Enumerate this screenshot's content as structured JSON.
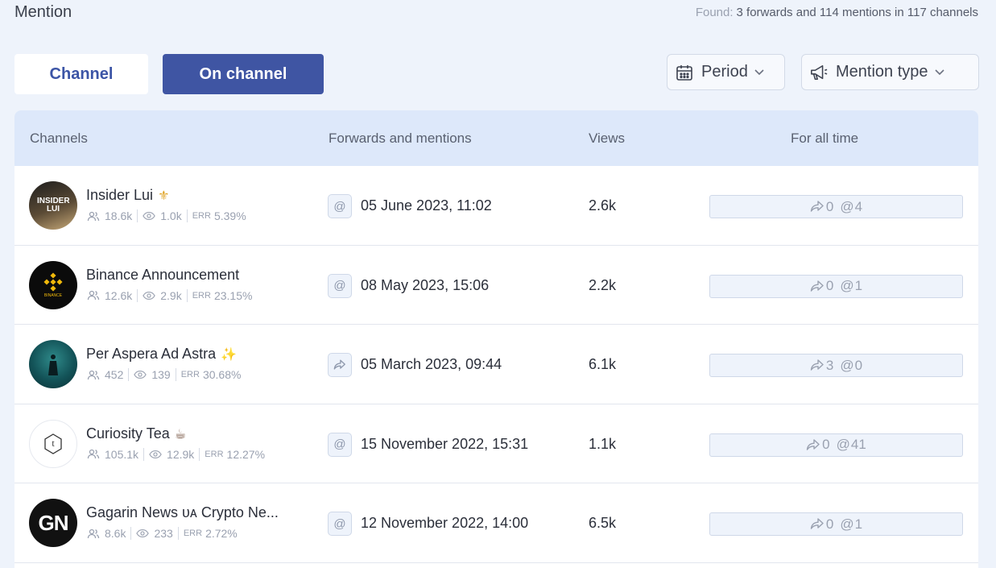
{
  "header": {
    "title": "Mention",
    "found_label": "Found:",
    "found_text": "3 forwards and 114 mentions in 117 channels"
  },
  "tabs": {
    "channel": "Channel",
    "on_channel": "On channel"
  },
  "filters": {
    "period": "Period",
    "mention_type": "Mention type"
  },
  "table": {
    "columns": {
      "channels": "Channels",
      "forwards": "Forwards and mentions",
      "views": "Views",
      "all_time": "For all time"
    },
    "rows": [
      {
        "name": "Insider Lui",
        "emoji": "⚜",
        "subscribers": "18.6k",
        "reach": "1.0k",
        "err_label": "ERR",
        "err": "5.39%",
        "type_icon": "at-icon",
        "date": "05 June 2023, 11:02",
        "views": "2.6k",
        "forwards": "0",
        "mentions": "4"
      },
      {
        "name": "Binance Announcement",
        "emoji": "",
        "subscribers": "12.6k",
        "reach": "2.9k",
        "err_label": "ERR",
        "err": "23.15%",
        "type_icon": "at-icon",
        "date": "08 May 2023, 15:06",
        "views": "2.2k",
        "forwards": "0",
        "mentions": "1"
      },
      {
        "name": "Per Aspera Ad Astra",
        "emoji": "✨",
        "subscribers": "452",
        "reach": "139",
        "err_label": "ERR",
        "err": "30.68%",
        "type_icon": "share-icon",
        "date": "05 March 2023, 09:44",
        "views": "6.1k",
        "forwards": "3",
        "mentions": "0"
      },
      {
        "name": "Curiosity Tea",
        "emoji": "☕",
        "subscribers": "105.1k",
        "reach": "12.9k",
        "err_label": "ERR",
        "err": "12.27%",
        "type_icon": "at-icon",
        "date": "15 November 2022, 15:31",
        "views": "1.1k",
        "forwards": "0",
        "mentions": "41"
      },
      {
        "name": "Gagarin News ᴜᴀ Crypto Ne...",
        "emoji": "",
        "subscribers": "8.6k",
        "reach": "233",
        "err_label": "ERR",
        "err": "2.72%",
        "type_icon": "at-icon",
        "date": "12 November 2022, 14:00",
        "views": "6.5k",
        "forwards": "0",
        "mentions": "1"
      }
    ]
  },
  "avatar_text": {
    "insider_lui": "INSIDER LUI",
    "gagarin": "GN",
    "curiosity": "t",
    "binance": "BINANCE"
  },
  "colors": {
    "accent": "#3f55a3",
    "header_bg": "#dde8fa",
    "page_bg": "#eef3fb"
  }
}
